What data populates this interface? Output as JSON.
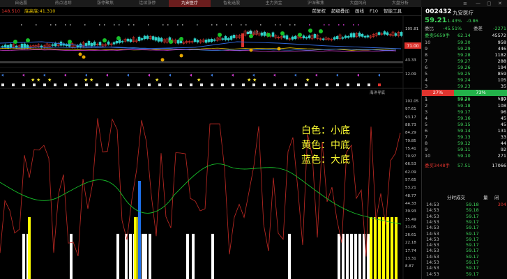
{
  "tabs": [
    "自选股",
    "热点追踪",
    "涨停聚焦",
    "连续涨停",
    "九安医疗",
    "智能选股",
    "主力资金",
    "沪深聚焦",
    "大盘风向",
    "大盘分析"
  ],
  "active_tab_index": 4,
  "topbar": {
    "price_label": "148.510",
    "ind_label": "底高底:41.310",
    "right_items": [
      "前复权",
      "超级叠加",
      "画线",
      "F10",
      "智能工具"
    ]
  },
  "main_axis": [
    "105.81",
    "71.00",
    "43.33",
    "12.09"
  ],
  "lower_axis": [
    "102.05",
    "97.61",
    "93.17",
    "88.73",
    "84.29",
    "79.85",
    "75.41",
    "70.97",
    "66.53",
    "62.09",
    "57.65",
    "53.21",
    "48.77",
    "44.33",
    "39.93",
    "35.49",
    "31.05",
    "26.61",
    "22.18",
    "17.74",
    "13.31",
    "8.87"
  ],
  "panel_title": "海洋寻底",
  "peak_label": "99.12",
  "price_flag": "71.00",
  "legend": [
    "白色：小底",
    "黄色：中底",
    "蓝色：大底"
  ],
  "quote": {
    "code": "002432",
    "name": "九安医疗",
    "price": "59.21",
    "pct": "-1.43%",
    "chg": "-0.86",
    "committee": {
      "label": "委比",
      "value": "-45.51%",
      "diff_label": "委差",
      "diff": "-2271"
    },
    "sell_total": {
      "label": "委卖5659手",
      "price": "62.14",
      "vol": "45572"
    },
    "asks": [
      {
        "lvl": "10",
        "price": "59.30",
        "vol": "958"
      },
      {
        "lvl": "9",
        "price": "59.29",
        "vol": "446"
      },
      {
        "lvl": "8",
        "price": "59.28",
        "vol": "1182"
      },
      {
        "lvl": "7",
        "price": "59.27",
        "vol": "288"
      },
      {
        "lvl": "6",
        "price": "59.26",
        "vol": "194"
      },
      {
        "lvl": "5",
        "price": "59.25",
        "vol": "859"
      },
      {
        "lvl": "4",
        "price": "59.24",
        "vol": "105"
      },
      {
        "lvl": "3",
        "price": "59.23",
        "vol": "35"
      },
      {
        "lvl": "2",
        "price": "59.22",
        "vol": "115"
      },
      {
        "lvl": "1",
        "price": "59.21",
        "vol": "530"
      }
    ],
    "buy_pct": "27%",
    "sell_pct": "73%",
    "bids": [
      {
        "lvl": "1",
        "price": "59.20",
        "vol": "57"
      },
      {
        "lvl": "2",
        "price": "59.18",
        "vol": "108"
      },
      {
        "lvl": "3",
        "price": "59.17",
        "vol": "96"
      },
      {
        "lvl": "4",
        "price": "59.16",
        "vol": "45"
      },
      {
        "lvl": "5",
        "price": "59.15",
        "vol": "45"
      },
      {
        "lvl": "6",
        "price": "59.14",
        "vol": "131"
      },
      {
        "lvl": "7",
        "price": "59.13",
        "vol": "33"
      },
      {
        "lvl": "8",
        "price": "59.12",
        "vol": "44"
      },
      {
        "lvl": "9",
        "price": "59.11",
        "vol": "92"
      },
      {
        "lvl": "10",
        "price": "59.10",
        "vol": "271"
      }
    ],
    "buy_total": {
      "label": "委买3448手",
      "price": "57.51",
      "vol": "17066"
    },
    "tick_header": {
      "title": "分时成交",
      "btn1": "量",
      "btn2": "闭"
    },
    "ticks": [
      {
        "t": "14:53",
        "p": "59.18",
        "v": "304"
      },
      {
        "t": "14:53",
        "p": "59.18",
        "v": ""
      },
      {
        "t": "14:53",
        "p": "59.17",
        "v": ""
      },
      {
        "t": "14:53",
        "p": "59.17",
        "v": ""
      },
      {
        "t": "14:53",
        "p": "59.17",
        "v": ""
      },
      {
        "t": "14:53",
        "p": "59.17",
        "v": ""
      },
      {
        "t": "14:53",
        "p": "59.17",
        "v": ""
      },
      {
        "t": "14:53",
        "p": "59.17",
        "v": ""
      },
      {
        "t": "14:53",
        "p": "59.17",
        "v": ""
      },
      {
        "t": "14:53",
        "p": "59.17",
        "v": ""
      },
      {
        "t": "14:53",
        "p": "59.17",
        "v": ""
      },
      {
        "t": "14:53",
        "p": "59.17",
        "v": ""
      },
      {
        "t": "14:53",
        "p": "59.17",
        "v": ""
      }
    ]
  },
  "colors": {
    "up": "#e0342e",
    "down": "#3fd45b",
    "white": "#ffffff",
    "yellow": "#ffff00",
    "blue": "#1e6fe8",
    "ma_green": "#17c12a"
  }
}
